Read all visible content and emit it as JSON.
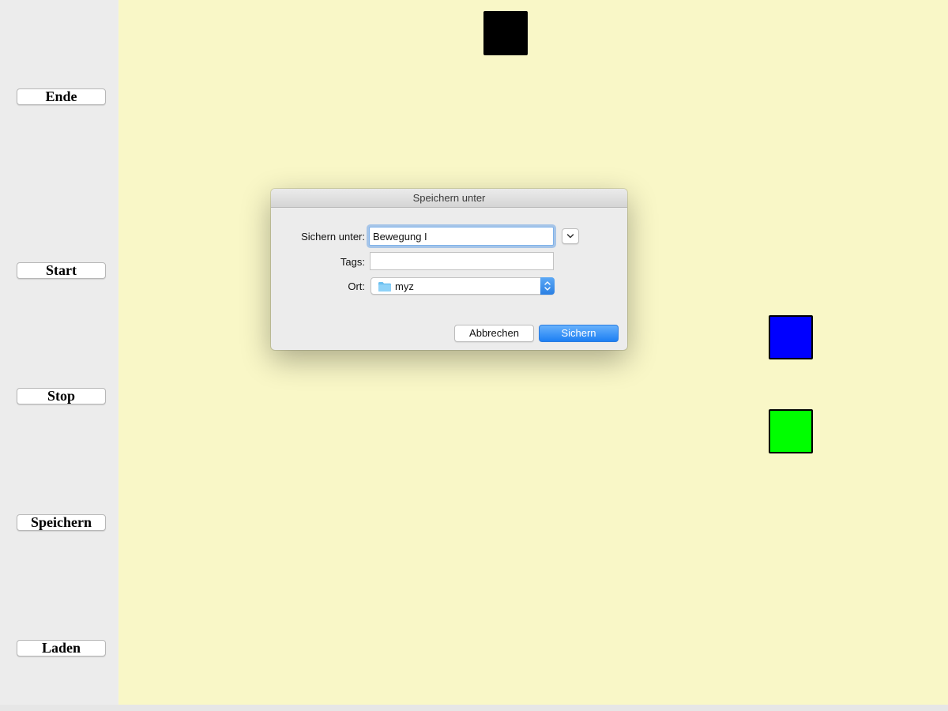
{
  "sidebar": {
    "buttons": [
      {
        "label": "Ende"
      },
      {
        "label": "Start"
      },
      {
        "label": "Stop"
      },
      {
        "label": "Speichern"
      },
      {
        "label": "Laden"
      }
    ]
  },
  "canvas": {
    "background": "#f9f7c7",
    "shapes": [
      {
        "name": "black-square",
        "color": "#000000"
      },
      {
        "name": "blue-square",
        "color": "#0000ff"
      },
      {
        "name": "green-square",
        "color": "#00ff00"
      }
    ]
  },
  "dialog": {
    "title": "Speichern unter",
    "save_as_label": "Sichern unter:",
    "save_as_value": "Bewegung I",
    "tags_label": "Tags:",
    "tags_value": "",
    "location_label": "Ort:",
    "location_value": "myz",
    "cancel_label": "Abbrechen",
    "save_label": "Sichern",
    "accent_color": "#1d7ff3"
  }
}
